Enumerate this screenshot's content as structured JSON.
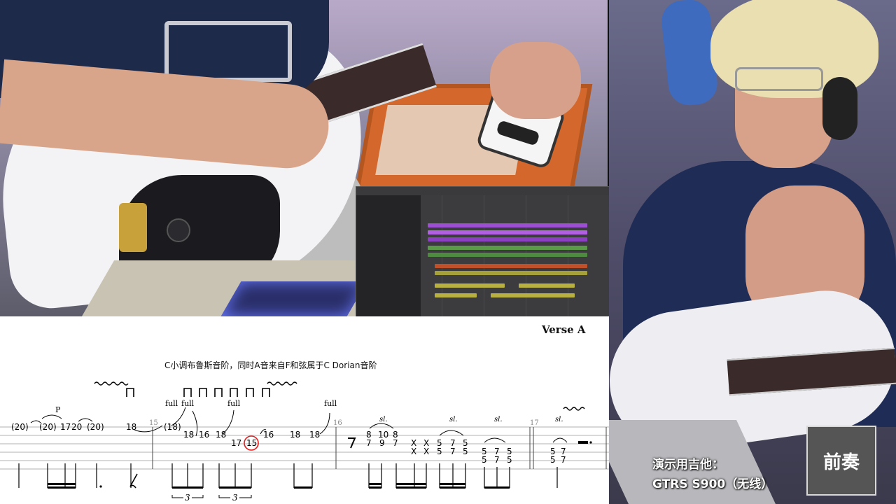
{
  "sheet": {
    "section_title": "Verse A",
    "description": "C小调布鲁斯音阶，同时A音来自F和弦属于C Dorian音阶",
    "measure_numbers": [
      "15",
      "16",
      "17"
    ],
    "bends": [
      "full",
      "full",
      "full",
      "full"
    ],
    "slides": [
      "sl.",
      "sl.",
      "sl.",
      "sl."
    ],
    "pull_off": "P",
    "triplets": [
      "3",
      "3"
    ],
    "string1": [
      "(20)",
      "(20)",
      "17",
      "20",
      "(20)",
      "18",
      "(18)"
    ],
    "string2": [
      "18",
      "16",
      "18",
      "18",
      "18",
      "16"
    ],
    "string3": [
      "17",
      "15"
    ],
    "col1": [
      "8",
      "10",
      "8"
    ],
    "col2": [
      "7",
      "9",
      "7"
    ],
    "dead": [
      "X",
      "X",
      "X",
      "X"
    ],
    "slide_notes": [
      "5",
      "7",
      "5",
      "5",
      "7",
      "5",
      "5",
      "7",
      "5",
      "5",
      "7",
      "5",
      "5",
      "7",
      "5",
      "7"
    ]
  },
  "caption": {
    "line1": "演示用吉他：",
    "line2": "GTRS S900（无线）"
  },
  "badge": "前奏",
  "colors": {
    "tab_background": "#ffffff",
    "highlight_circle": "#e02020",
    "badge_bg": "#555555",
    "badge_border": "#d9d9d9"
  }
}
